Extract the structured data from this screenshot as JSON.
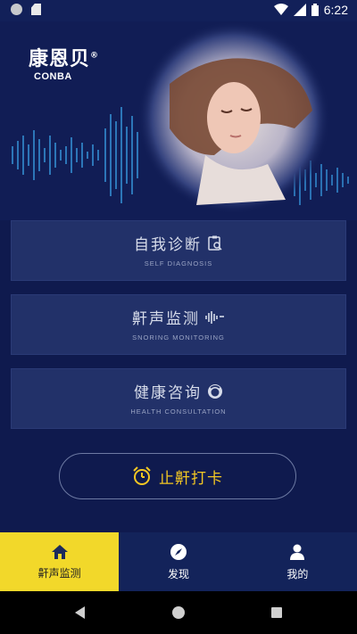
{
  "status_bar": {
    "time": "6:22"
  },
  "logo": {
    "name_cn": "康恩贝",
    "mark": "®",
    "name_en": "CONBA"
  },
  "menu": [
    {
      "title": "自我诊断",
      "subtitle": "SELF DIAGNOSIS",
      "icon": "clipboard-search-icon"
    },
    {
      "title": "鼾声监测",
      "subtitle": "SNORING MONITORING",
      "icon": "sound-wave-icon"
    },
    {
      "title": "健康咨询",
      "subtitle": "HEALTH CONSULTATION",
      "icon": "doctor-icon"
    }
  ],
  "checkin": {
    "label": "止鼾打卡",
    "icon": "alarm-clock-icon"
  },
  "tabs": [
    {
      "label": "鼾声监测",
      "icon": "home-icon",
      "active": true
    },
    {
      "label": "发现",
      "icon": "compass-icon",
      "active": false
    },
    {
      "label": "我的",
      "icon": "person-icon",
      "active": false
    }
  ],
  "colors": {
    "background": "#0f1a4e",
    "card": "#223169",
    "accent_yellow": "#f2d82a",
    "checkin_text": "#f2c623"
  }
}
